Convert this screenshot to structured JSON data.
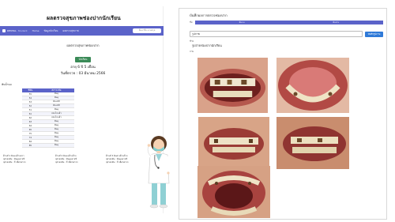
{
  "left_screenshot": {
    "site_title": "ผลตรวจสุขภาพช่องปากนักเรียน",
    "navbar": {
      "brand": "DENTAL",
      "brand_sub": "Student",
      "links": [
        "Home",
        "ข้อมูลนักเรียน",
        "ผลตรวจสุขภาพ"
      ],
      "search_placeholder": "ค้นหาชื่อ-นามสกุล"
    },
    "profile": {
      "title": "ผลตรวจสุขภาพช่องปาก",
      "badge": "นักเรียน",
      "age": "อายุ 6 ปี 5 เดือน",
      "check_date": "วันที่ตรวจ : 03 มีนาคม 2566"
    },
    "teeth_caption": "ฟันน้ำนม",
    "teeth_table": {
      "headers": [
        "ซี่ฟัน",
        "สภาวะฟัน"
      ],
      "rows": [
        [
          "55",
          "ฟันผุ"
        ],
        [
          "54",
          "ฟันผุ"
        ],
        [
          "53",
          "ฟันปกติ"
        ],
        [
          "52",
          "ฟันปกติ"
        ],
        [
          "51",
          "ฟันผุ"
        ],
        [
          "61",
          "ถอนไปแล้ว"
        ],
        [
          "62",
          "ถอนไปแล้ว"
        ],
        [
          "63",
          "ฟันผุ"
        ],
        [
          "64",
          "ฟันผุ"
        ],
        [
          "65",
          "ฟันผุ"
        ],
        [
          "75",
          "ฟันผุ"
        ],
        [
          "74",
          "ฟันผุ"
        ],
        [
          "84",
          "ฟันผุ"
        ],
        [
          "85",
          "ฟันผุ"
        ]
      ]
    },
    "legends": [
      [
        "ด้านที่ 1 ฟันบนด้านขวา",
        "จุดรอยฟัน : ฟันผุหลายซี่",
        "จุดรอยฟัน : ถ้าเลือกตรวจ"
      ],
      [
        "ด้านที่ 2 ฟันบนด้านซ้าย",
        "จุดรอยฟัน : ฟันผุหลายซี่",
        "จุดรอยฟัน : ถ้าเลือกตรวจ"
      ],
      [
        "ด้านที่ 3 ฟันล่างด้านซ้าย",
        "จุดรอยฟัน : ฟันผุหลายซี่",
        "จุดรอยฟัน : ถ้าเลือกตรวจ"
      ]
    ]
  },
  "right_screenshot": {
    "heading": "บันทึกผลการตรวจช่องปาก",
    "dropdown_label": "ชื่อ",
    "dropdown_values": [
      "ฟันบน",
      "ฟันล่าง"
    ],
    "input_label": "รูปภาพ",
    "input_value": "ผ่าตัด",
    "submit_label": "บันทึกรูปภาพ",
    "small_label_1": "ซ้าย",
    "small_label_2": "ภาพ",
    "photos_title": "รูปถ่ายช่องปากนักเรียน",
    "photos": [
      "front-teeth-photo",
      "upper-palate-photo",
      "smile-photo",
      "side-teeth-photo",
      "open-mouth-photo"
    ]
  },
  "colors": {
    "navbar": "#5b63c9",
    "badge": "#3a8a57",
    "button": "#2f7ad8"
  }
}
